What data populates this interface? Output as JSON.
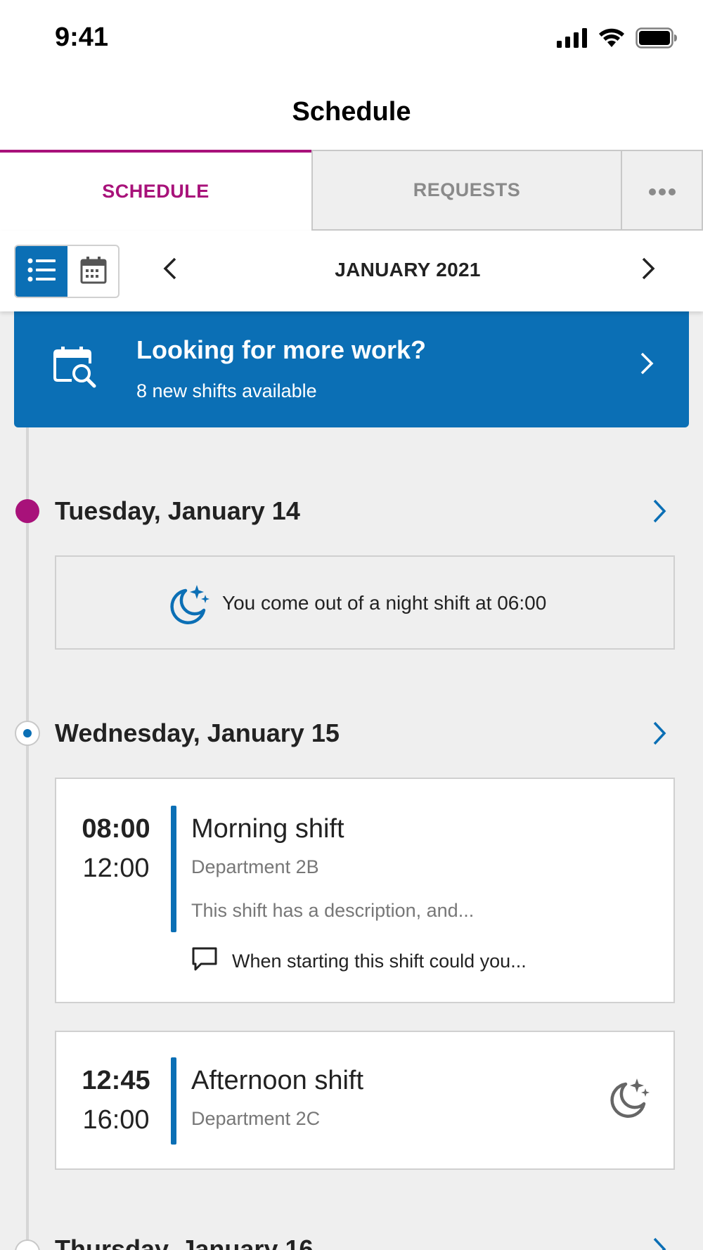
{
  "status_bar": {
    "time": "9:41",
    "icons": [
      "signal-icon",
      "wifi-icon",
      "battery-icon"
    ]
  },
  "header": {
    "title": "Schedule"
  },
  "tabs": [
    {
      "label": "SCHEDULE",
      "active": true
    },
    {
      "label": "REQUESTS",
      "active": false
    },
    {
      "label": "•••",
      "active": false
    }
  ],
  "toolbar": {
    "view_modes": [
      "list-view-icon",
      "calendar-view-icon"
    ],
    "active_view": "list",
    "month": "JANUARY 2021"
  },
  "banner": {
    "title": "Looking for more work?",
    "subtitle": "8 new shifts available"
  },
  "days": [
    {
      "heading": "Tuesday, January 14",
      "notice": "You come out of a night shift at 06:00"
    },
    {
      "heading": "Wednesday, January 15",
      "shifts": [
        {
          "start": "08:00",
          "end": "12:00",
          "name": "Morning shift",
          "department": "Department 2B",
          "description": "This shift has a description, and...",
          "note": "When starting this shift could you..."
        },
        {
          "start": "12:45",
          "end": "16:00",
          "name": "Afternoon shift",
          "department": "Department 2C",
          "night_indicator": true
        }
      ]
    },
    {
      "heading": "Thursday, January 16"
    }
  ],
  "colors": {
    "primary_blue": "#0b6fb5",
    "accent_magenta": "#a8127a",
    "background": "#efefef"
  }
}
